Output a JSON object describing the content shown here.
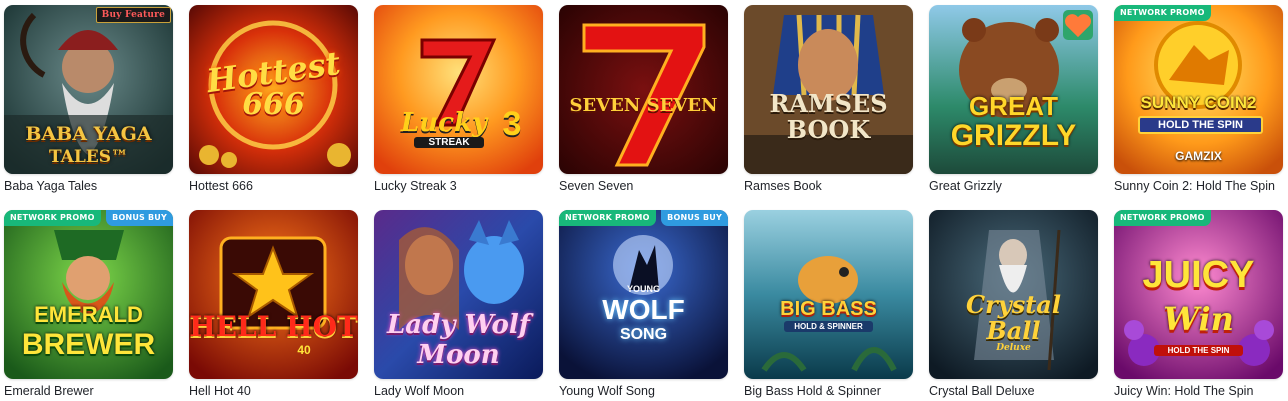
{
  "colors": {
    "network_promo_badge": "#18b87a",
    "bonus_buy_badge": "#2f9be0",
    "title_text": "#1f2228"
  },
  "badges": {
    "network_promo": "NETWORK PROMO",
    "bonus_buy": "BONUS BUY",
    "buy_feature": "Buy Feature"
  },
  "games": [
    {
      "title": "Baba Yaga Tales",
      "logo": "BABA YAGA",
      "logo2": "TALES™"
    },
    {
      "title": "Hottest 666",
      "logo": "Hottest",
      "logo2": "666"
    },
    {
      "title": "Lucky Streak 3",
      "logo": "Lucky",
      "logo2": "STREAK",
      "logo3": "3"
    },
    {
      "title": "Seven Seven",
      "logo": "SEVEN SEVEN"
    },
    {
      "title": "Ramses Book",
      "logo": "RAMSES",
      "logo2": "BOOK"
    },
    {
      "title": "Great Grizzly",
      "logo": "GREAT",
      "logo2": "GRIZZLY"
    },
    {
      "title": "Sunny Coin 2: Hold The Spin",
      "logo": "SUNNY COIN2",
      "logo2": "HOLD THE SPIN",
      "logo3": "GAMZIX"
    },
    {
      "title": "Emerald Brewer",
      "logo": "EMERALD",
      "logo2": "BREWER"
    },
    {
      "title": "Hell Hot 40",
      "logo": "HELL HOT",
      "logo2": "40"
    },
    {
      "title": "Lady Wolf Moon",
      "logo": "Lady Wolf",
      "logo2": "Moon"
    },
    {
      "title": "Young Wolf Song",
      "logo": "YOUNG",
      "logo2": "WOLF",
      "logo3": "SONG"
    },
    {
      "title": "Big Bass Hold & Spinner",
      "logo": "BIG BASS",
      "logo2": "HOLD & SPINNER"
    },
    {
      "title": "Crystal Ball Deluxe",
      "logo": "Crystal",
      "logo2": "Ball",
      "logo3": "Deluxe"
    },
    {
      "title": "Juicy Win: Hold The Spin",
      "logo": "JUICY",
      "logo2": "Win",
      "logo3": "HOLD THE SPIN"
    }
  ]
}
